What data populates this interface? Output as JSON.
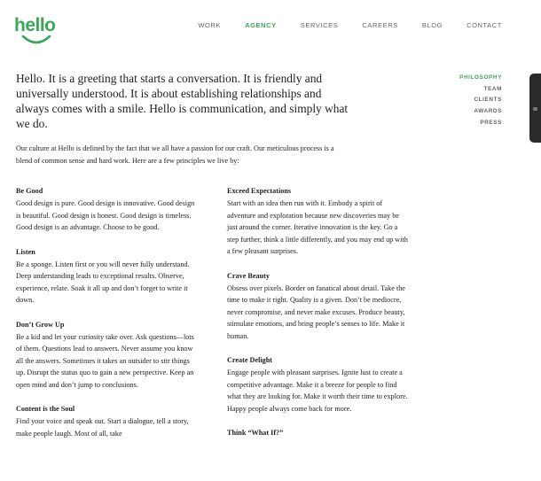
{
  "brand": {
    "logo_text": "hello",
    "accent": "#3aa757"
  },
  "topnav": [
    {
      "label": "WORK",
      "active": false
    },
    {
      "label": "AGENCY",
      "active": true
    },
    {
      "label": "SERVICES",
      "active": false
    },
    {
      "label": "CAREERS",
      "active": false
    },
    {
      "label": "BLOG",
      "active": false
    },
    {
      "label": "CONTACT",
      "active": false
    }
  ],
  "subnav": [
    {
      "label": "PHILOSOPHY",
      "active": true
    },
    {
      "label": "TEAM",
      "active": false
    },
    {
      "label": "CLIENTS",
      "active": false
    },
    {
      "label": "AWARDS",
      "active": false
    },
    {
      "label": "PRESS",
      "active": false
    }
  ],
  "intro": "Hello. It is a greeting that starts a conversation. It is friendly and universally understood. It is about establishing relationships and always comes with a smile. Hello is communication, and simply what we do.",
  "lede": "Our culture at Hello is defined by the fact that we all have a passion for our craft. Our meticulous process is a blend of common sense and hard work. Here are a few principles we live by:",
  "principles_left": [
    {
      "title": "Be Good",
      "body": "Good design is pure. Good design is innovative. Good design is beautiful. Good design is honest. Good design is timeless. Good design is an advantage. Choose to be good."
    },
    {
      "title": "Listen",
      "body": "Be a sponge. Listen first or you will never fully understand. Deep understanding leads to exceptional results. Observe, experience, relate. Soak it all up and don’t forget to write it down."
    },
    {
      "title": "Don’t Grow Up",
      "body": "Be a kid and let your curiosity take over. Ask questions—lots of them. Questions lead to answers. Never assume you know all the answers. Sometimes it takes an outsider to stir things up. Disrupt the status quo to gain a new perspective. Keep an open mind and don’t jump to conclusions."
    },
    {
      "title": "Content is the Soul",
      "body": "Find your voice and speak out. Start a dialogue, tell a story, make people laugh. Most of all, take"
    }
  ],
  "principles_right": [
    {
      "title": "Exceed Expectations",
      "body": "Start with an idea then run with it. Embody a spirit of adventure and exploration because new discoveries may be just around the corner. Iterative innovation is the key. Go a step further, think a little differently, and you may end up with a few pleasant surprises."
    },
    {
      "title": "Crave Beauty",
      "body": "Obsess over pixels. Border on fanatical about detail. Take the time to make it right. Quality is a given. Don’t be mediocre, never compromise, and never make excuses. Produce beauty, stimulate emotions, and bring people’s senses to life. Make it human."
    },
    {
      "title": "Create Delight",
      "body": "Engage people with pleasant surprises. Ignite lust to create a competitive advantage. Make it a breeze for people to find what they are looking for. Make it worth their time to explore. Happy people always come back for more."
    },
    {
      "title": "Think “What If?”",
      "body": ""
    }
  ]
}
